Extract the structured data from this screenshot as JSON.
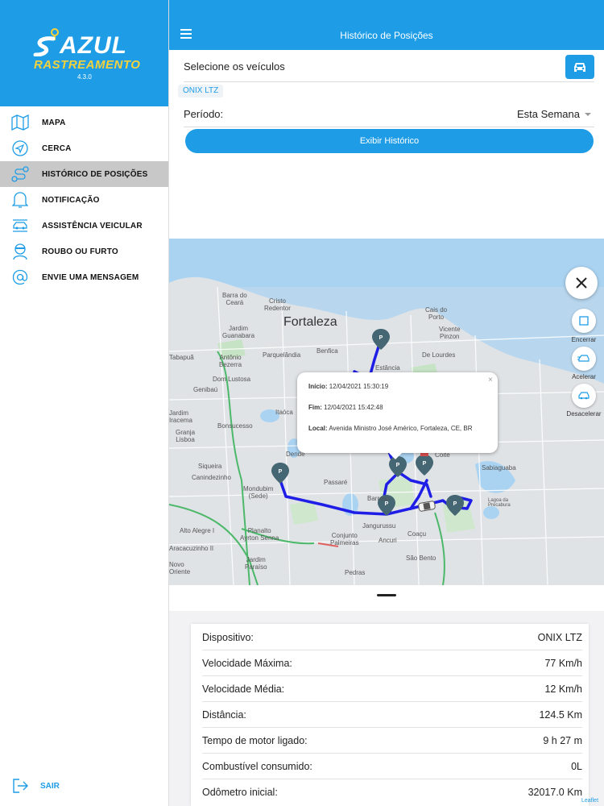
{
  "brand": {
    "name": "AZUL",
    "subtitle": "RASTREAMENTO",
    "version": "4.3.0"
  },
  "sidebar": {
    "items": [
      {
        "label": "MAPA",
        "icon": "map-icon"
      },
      {
        "label": "CERCA",
        "icon": "navigation-icon"
      },
      {
        "label": "HISTÓRICO DE POSIÇÕES",
        "icon": "route-icon",
        "active": true
      },
      {
        "label": "NOTIFICAÇÃO",
        "icon": "bell-icon"
      },
      {
        "label": "ASSISTÊNCIA VEICULAR",
        "icon": "car-service-icon"
      },
      {
        "label": "ROUBO OU FURTO",
        "icon": "thief-icon"
      },
      {
        "label": "ENVIE UMA MENSAGEM",
        "icon": "at-icon"
      }
    ],
    "logout": "SAIR"
  },
  "header": {
    "title": "Histórico de Posições"
  },
  "form": {
    "vehicle_label": "Selecione os veículos",
    "selected_vehicle": "ONIX LTZ",
    "period_label": "Período:",
    "period_value": "Esta Semana",
    "show_button": "Exibir Histórico"
  },
  "map": {
    "places": {
      "fortaleza": "Fortaleza",
      "barra_do_ceara": "Barra do\nCeará",
      "cristo_redentor": "Cristo\nRedentor",
      "jardim_guanabara": "Jardim\nGuanabara",
      "parquelandia": "Parquelândia",
      "benfica": "Benfica",
      "tabapua": "Tabapuã",
      "antonio_bezerra": "Antônio\nBezerra",
      "dom_lustosa": "Dom Lustosa",
      "genibau": "Genibaú",
      "bonsucesso": "Bonsucesso",
      "itaoca": "Itaóca",
      "jardim_iracema": "Jardim\nIracema",
      "granja_lisboa": "Granja\nLisboa",
      "siqueira": "Siqueira",
      "canindezinho": "Canindezinho",
      "dende": "Dendê",
      "mondubim": "Mondubim\n(Sede)",
      "passare": "Passaré",
      "barroso": "Barroso",
      "alto_alegre": "Alto Alegre I",
      "planalto_ayrton": "Planalto\nAyrton Senna",
      "aracauzinho": "Aracacuzinho II",
      "jardim_paraiso": "Jardim\nParaíso",
      "novo_oriente": "Novo\nOriente",
      "conjunto_palmeiras": "Conjunto\nPalmeiras",
      "jangurussu": "Jangurussu",
      "ancuri": "Ancuri",
      "coacu": "Coaçu",
      "sao_bento": "São Bento",
      "pedras": "Pedras",
      "sabiaguaba": "Sabiaguaba",
      "cais_do_porto": "Cais do\nPorto",
      "vicente_pinzon": "Vicente\nPinzon",
      "de_lourdes": "De Lourdes",
      "estancia": "Estância",
      "coite": "Coité",
      "lagoa": "Lagoa da\nPrecabura"
    },
    "controls": {
      "stop": "Encerrar",
      "speed_up": "Acelerar",
      "slow_down": "Desacelerar"
    },
    "popup": {
      "start_label": "Início:",
      "start_value": "12/04/2021 15:30:19",
      "end_label": "Fim:",
      "end_value": "12/04/2021 15:42:48",
      "location_label": "Local:",
      "location_value": "Avenida Ministro José Américo, Fortaleza, CE, BR"
    },
    "attribution": "Leaflet",
    "route_color": "#1e1ee6"
  },
  "stats": [
    {
      "label": "Dispositivo:",
      "value": "ONIX LTZ"
    },
    {
      "label": "Velocidade Máxima:",
      "value": "77 Km/h"
    },
    {
      "label": "Velocidade Média:",
      "value": "12 Km/h"
    },
    {
      "label": "Distância:",
      "value": "124.5 Km"
    },
    {
      "label": "Tempo de motor ligado:",
      "value": "9 h 27 m"
    },
    {
      "label": "Combustível consumido:",
      "value": "0L"
    },
    {
      "label": "Odômetro inicial:",
      "value": "32017.0 Km"
    }
  ],
  "colors": {
    "primary": "#1e9de6",
    "accent": "#f5d23a"
  }
}
